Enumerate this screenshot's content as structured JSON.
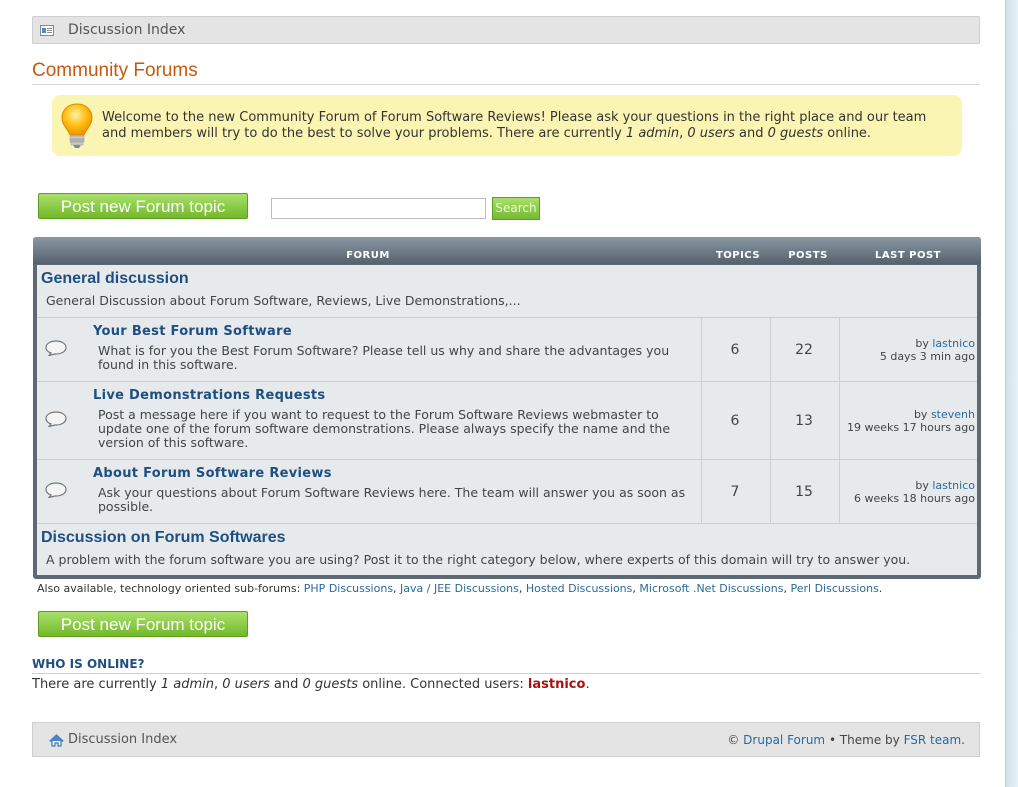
{
  "breadcrumb": {
    "label": "Discussion Index"
  },
  "page": {
    "title": "Community Forums"
  },
  "welcome": {
    "text_before": "Welcome to the new Community Forum of Forum Software Reviews! Please ask your questions in the right place and our team and members will try to do the best to solve your problems. There are currently ",
    "admins": "1 admin",
    "sep1": ", ",
    "users": "0 users",
    "sep2": " and ",
    "guests": "0 guests",
    "text_after": " online."
  },
  "actions": {
    "post_new_label": "Post new Forum topic",
    "search_placeholder": "",
    "search_label": "Search"
  },
  "table": {
    "headers": {
      "forum": "FORUM",
      "topics": "TOPICS",
      "posts": "POSTS",
      "last_post": "LAST POST"
    },
    "categories": [
      {
        "title": "General discussion",
        "description": "General Discussion about Forum Software, Reviews, Live Demonstrations,..."
      },
      {
        "title": "Discussion on Forum Softwares",
        "description": "A problem with the forum software you are using? Post it to the right category below, where experts of this domain will try to answer you."
      }
    ],
    "forums": [
      {
        "title": "Your Best Forum Software",
        "description": "What is for you the Best Forum Software? Please tell us why and share the advantages you found in this software.",
        "topics": "6",
        "posts": "22",
        "by": "by",
        "user": "lastnico",
        "when": "5 days 3 min ago"
      },
      {
        "title": "Live Demonstrations Requests",
        "description": "Post a message here if you want to request to the Forum Software Reviews webmaster to update one of the forum software demonstrations. Please always specify the name and the version of this software.",
        "topics": "6",
        "posts": "13",
        "by": "by",
        "user": "stevenh",
        "when": "19 weeks 17 hours ago"
      },
      {
        "title": "About Forum Software Reviews",
        "description": "Ask your questions about Forum Software Reviews here. The team will answer you as soon as possible.",
        "topics": "7",
        "posts": "15",
        "by": "by",
        "user": "lastnico",
        "when": "6 weeks 18 hours ago"
      }
    ]
  },
  "also": {
    "prefix": "Also available, technology oriented sub-forums: ",
    "links": [
      "PHP Discussions",
      "Java / JEE Discussions",
      "Hosted Discussions",
      "Microsoft .Net Discussions",
      "Perl Discussions"
    ],
    "sep": ", ",
    "suffix": "."
  },
  "online": {
    "title": "WHO IS ONLINE?",
    "prefix": "There are currently ",
    "admins": "1 admin",
    "sep1": ", ",
    "users": "0 users",
    "sep2": " and ",
    "guests": "0 guests",
    "middle": " online. Connected users: ",
    "connected_user": "lastnico",
    "suffix": "."
  },
  "footer": {
    "crumb": "Discussion Index",
    "copyright": "© ",
    "drupal_link": "Drupal Forum",
    "bullet": " • Theme by ",
    "team_link": "FSR team",
    "end": "."
  },
  "colors": {
    "accent_title": "#c45a10",
    "link": "#2a6a9a",
    "button_green": "#72b92a",
    "header_slate": "#5d6a76",
    "welcome_bg": "#fbf5b4"
  }
}
